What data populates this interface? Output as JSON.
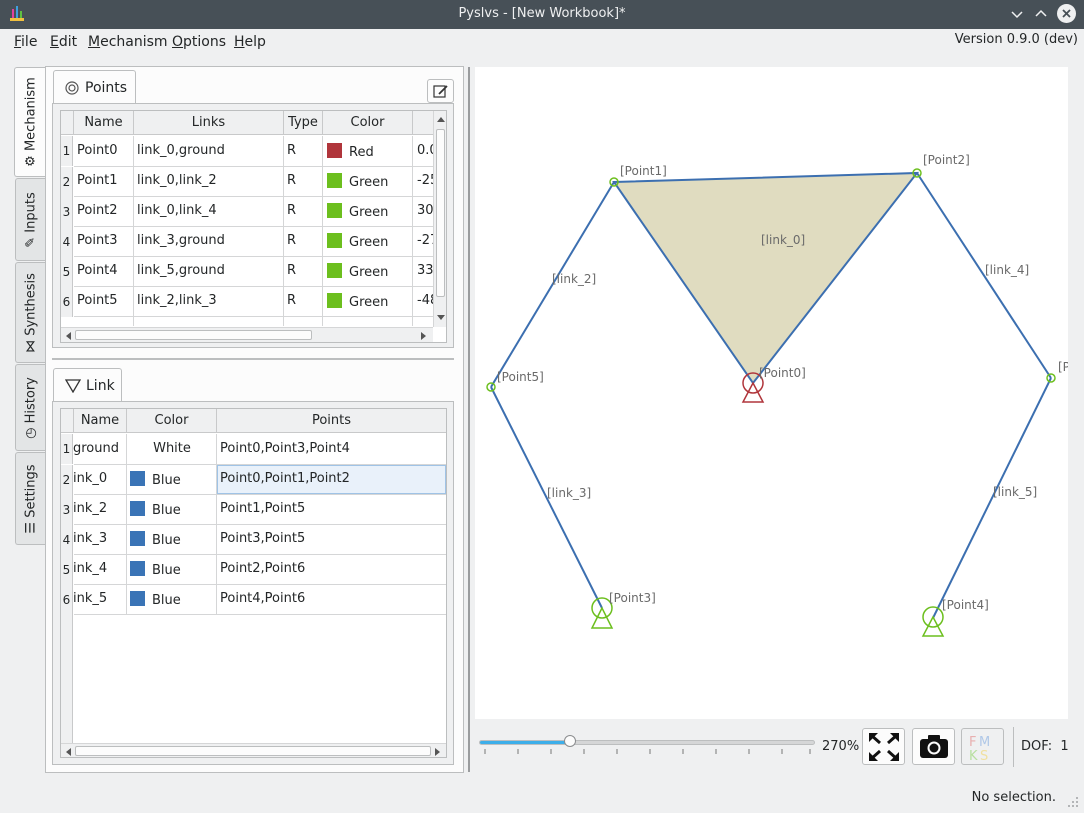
{
  "window": {
    "title": "Pyslvs - [New Workbook]*"
  },
  "menu": {
    "items": [
      {
        "u": "F",
        "rest": "ile"
      },
      {
        "u": "E",
        "rest": "dit"
      },
      {
        "u": "M",
        "rest": "echanism"
      },
      {
        "u": "O",
        "rest": "ptions"
      },
      {
        "u": "H",
        "rest": "elp"
      }
    ],
    "version": "Version 0.9.0 (dev)"
  },
  "side_tabs": [
    "Mechanism",
    "Inputs",
    "Synthesis",
    "History",
    "Settings"
  ],
  "points_panel": {
    "tab_label": "Points",
    "headers": [
      "Name",
      "Links",
      "Type",
      "Color"
    ],
    "rows": [
      {
        "n": "1",
        "name": "Point0",
        "links": "link_0,ground",
        "type": "R",
        "color": "Red",
        "hex": "#b0353b",
        "x": "0.0"
      },
      {
        "n": "2",
        "name": "Point1",
        "links": "link_0,link_2",
        "type": "R",
        "color": "Green",
        "hex": "#6cbf1e",
        "x": "-25"
      },
      {
        "n": "3",
        "name": "Point2",
        "links": "link_0,link_4",
        "type": "R",
        "color": "Green",
        "hex": "#6cbf1e",
        "x": "30."
      },
      {
        "n": "4",
        "name": "Point3",
        "links": "link_3,ground",
        "type": "R",
        "color": "Green",
        "hex": "#6cbf1e",
        "x": "-27"
      },
      {
        "n": "5",
        "name": "Point4",
        "links": "link_5,ground",
        "type": "R",
        "color": "Green",
        "hex": "#6cbf1e",
        "x": "33."
      },
      {
        "n": "6",
        "name": "Point5",
        "links": "link_2,link_3",
        "type": "R",
        "color": "Green",
        "hex": "#6cbf1e",
        "x": "-48"
      }
    ]
  },
  "link_panel": {
    "tab_label": "Link",
    "headers": [
      "Name",
      "Color",
      "Points"
    ],
    "rows": [
      {
        "n": "1",
        "name": "ground",
        "color": "White",
        "hex": "",
        "points": "Point0,Point3,Point4"
      },
      {
        "n": "2",
        "name": "ink_0",
        "color": "Blue",
        "hex": "#3a74b6",
        "points": "Point0,Point1,Point2"
      },
      {
        "n": "3",
        "name": "ink_2",
        "color": "Blue",
        "hex": "#3a74b6",
        "points": "Point1,Point5"
      },
      {
        "n": "4",
        "name": "ink_3",
        "color": "Blue",
        "hex": "#3a74b6",
        "points": "Point3,Point5"
      },
      {
        "n": "5",
        "name": "ink_4",
        "color": "Blue",
        "hex": "#3a74b6",
        "points": "Point2,Point6"
      },
      {
        "n": "6",
        "name": "ink_5",
        "color": "Blue",
        "hex": "#3a74b6",
        "points": "Point4,Point6"
      }
    ]
  },
  "canvas": {
    "point_labels": [
      "[Point1]",
      "[Point2]",
      "[Point5]",
      "[Point0]",
      "[P",
      "[Point3]",
      "[Point4]"
    ],
    "link_labels": [
      "[link_0]",
      "[link_2]",
      "[link_4]",
      "[link_3]",
      "[link_5]"
    ]
  },
  "zoom": {
    "label": "270%",
    "level_percent": 27
  },
  "dof": "DOF:  1",
  "status": "No selection.",
  "colors": {
    "link_line": "#3c6fb0",
    "ground_triangle": "#e0dcc0",
    "green_joint": "#6cbf1e",
    "red_joint": "#b0353b"
  }
}
